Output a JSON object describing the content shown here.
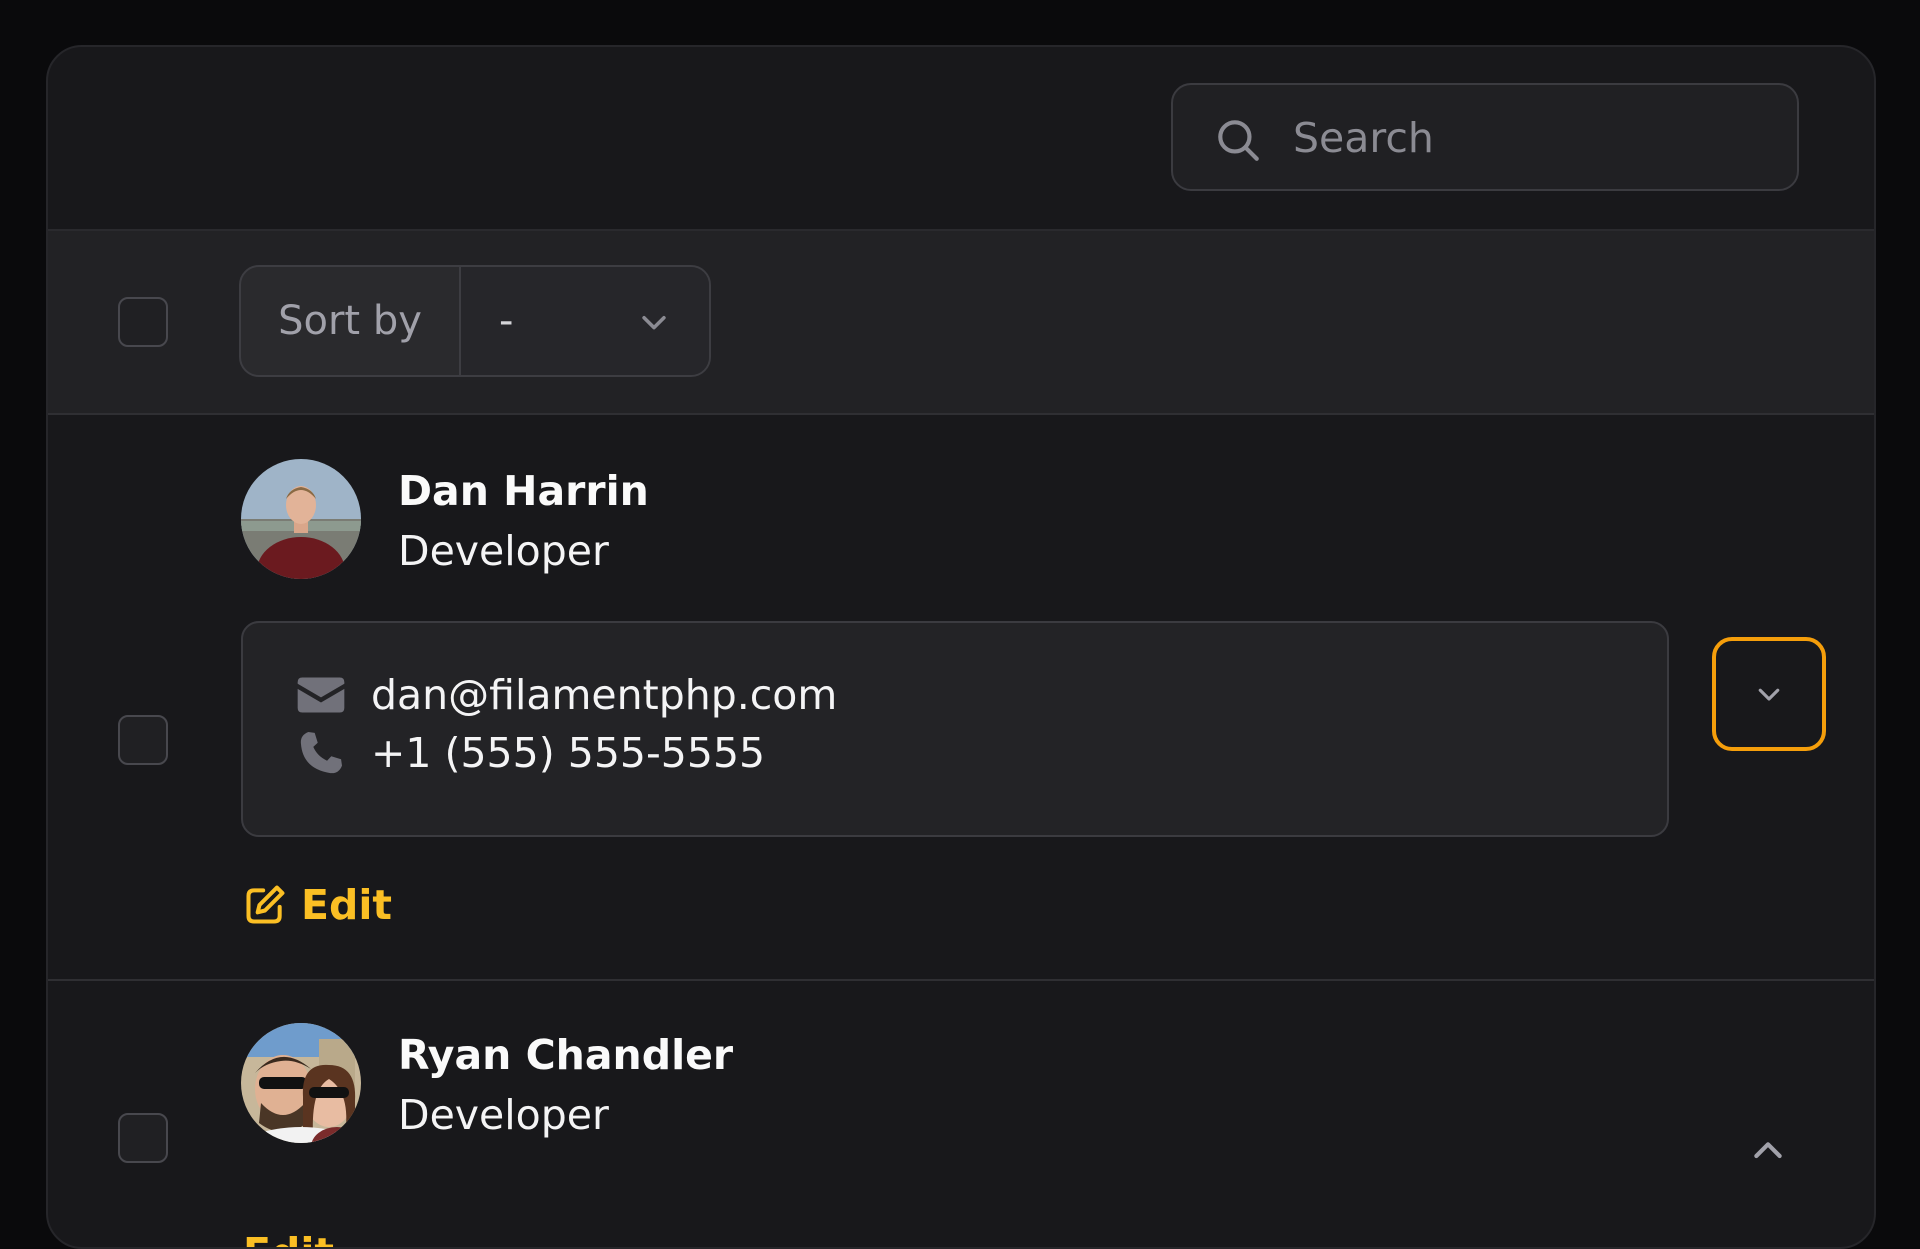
{
  "search": {
    "placeholder": "Search"
  },
  "toolbar": {
    "sort_label": "Sort by",
    "sort_value": "-"
  },
  "rows": [
    {
      "name": "Dan Harrin",
      "role": "Developer",
      "email": "dan@filamentphp.com",
      "phone": "+1 (555) 555-5555",
      "edit_label": "Edit"
    },
    {
      "name": "Ryan Chandler",
      "role": "Developer",
      "edit_label": "Edit"
    }
  ],
  "colors": {
    "accent": "#f59e0b",
    "edit": "#fbbf24",
    "background": "#18181b"
  }
}
